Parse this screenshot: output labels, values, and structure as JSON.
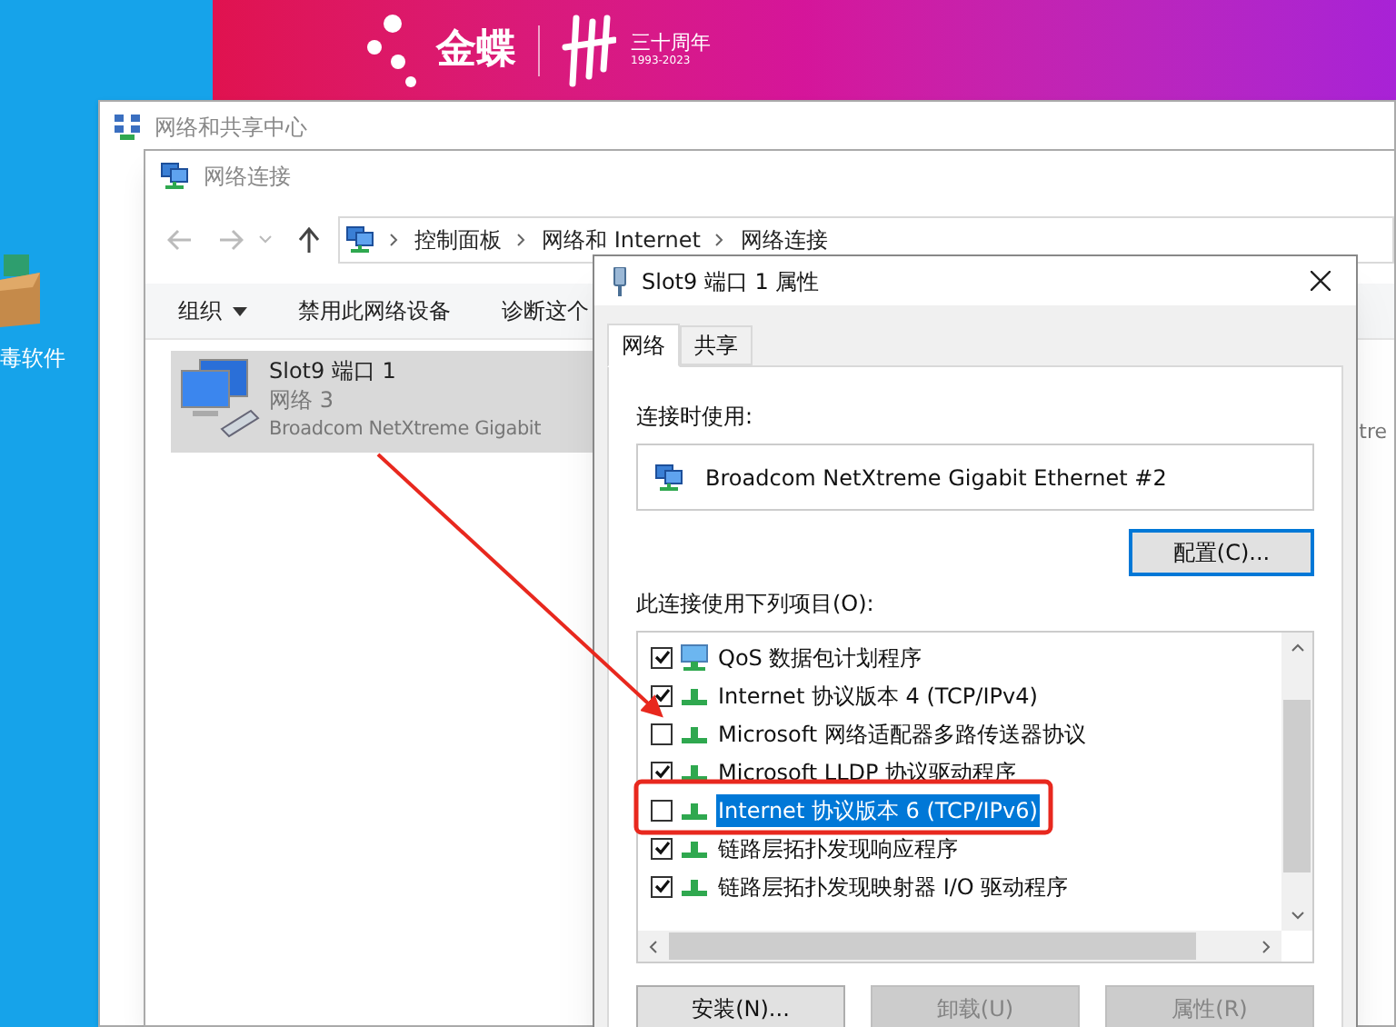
{
  "banner": {
    "logo_text": "金蝶",
    "anniversary": "三十周年",
    "years": "1993-2023"
  },
  "desktop_icon": {
    "label": "毒软件"
  },
  "back_window": {
    "title": "网络和共享中心"
  },
  "connections_window": {
    "title": "网络连接",
    "breadcrumb": [
      "控制面板",
      "网络和 Internet",
      "网络连接"
    ],
    "toolbar": [
      {
        "label": "组织",
        "kind": "menu"
      },
      {
        "label": "禁用此网络设备",
        "kind": "plain"
      },
      {
        "label": "诊断这个",
        "kind": "plain"
      }
    ],
    "adapters": [
      {
        "name": "Slot9 端口 1",
        "network": "网络 3",
        "device": "Broadcom NetXtreme Gigabit",
        "selected": true
      }
    ],
    "column_2_fragment": "tre"
  },
  "dialog": {
    "title": "Slot9 端口 1 属性",
    "tabs": [
      {
        "label": "网络",
        "selected": true
      },
      {
        "label": "共享",
        "selected": false
      }
    ],
    "connect_using_label": "连接时使用:",
    "adapter": "Broadcom NetXtreme Gigabit Ethernet #2",
    "configure_button": "配置(C)...",
    "items_label": "此连接使用下列项目(O):",
    "items": [
      {
        "label": "QoS 数据包计划程序",
        "checked": true,
        "selected": false,
        "kind": "scheduler"
      },
      {
        "label": "Internet 协议版本 4 (TCP/IPv4)",
        "checked": true,
        "selected": false,
        "kind": "protocol"
      },
      {
        "label": "Microsoft 网络适配器多路传送器协议",
        "checked": false,
        "selected": false,
        "kind": "protocol"
      },
      {
        "label": "Microsoft LLDP 协议驱动程序",
        "checked": true,
        "selected": false,
        "kind": "protocol"
      },
      {
        "label": "Internet 协议版本 6 (TCP/IPv6)",
        "checked": false,
        "selected": true,
        "kind": "protocol"
      },
      {
        "label": "链路层拓扑发现响应程序",
        "checked": true,
        "selected": false,
        "kind": "protocol"
      },
      {
        "label": "链路层拓扑发现映射器 I/O 驱动程序",
        "checked": true,
        "selected": false,
        "kind": "protocol"
      }
    ],
    "buttons": [
      {
        "label": "安装(N)...",
        "disabled": false
      },
      {
        "label": "卸载(U)",
        "disabled": true
      },
      {
        "label": "属性(R)",
        "disabled": true
      }
    ]
  }
}
